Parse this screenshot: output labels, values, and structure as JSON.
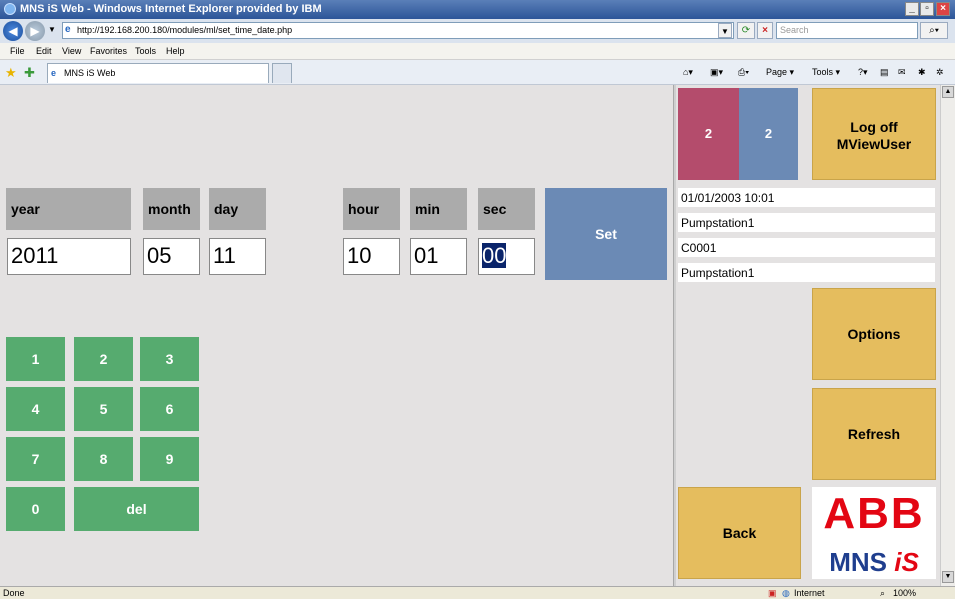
{
  "window": {
    "title": "MNS iS Web - Windows Internet Explorer provided by IBM",
    "minimize": "_",
    "maximize": "▫",
    "close": "×"
  },
  "address": {
    "url": "http://192.168.200.180/modules/ml/set_time_date.php",
    "search_placeholder": "Search",
    "back_icon": "◀",
    "forward_icon": "▶"
  },
  "menu": [
    "File",
    "Edit",
    "View",
    "Favorites",
    "Tools",
    "Help"
  ],
  "tab": {
    "label": "MNS iS Web"
  },
  "commandbar": {
    "page": "Page ▾",
    "tools": "Tools ▾",
    "zoom": "100%"
  },
  "datetime": {
    "headers": {
      "year": "year",
      "month": "month",
      "day": "day",
      "hour": "hour",
      "min": "min",
      "sec": "sec"
    },
    "values": {
      "year": "2011",
      "month": "05",
      "day": "11",
      "hour": "10",
      "min": "01",
      "sec": "00"
    },
    "set_label": "Set"
  },
  "keypad": {
    "keys": [
      "1",
      "2",
      "3",
      "4",
      "5",
      "6",
      "7",
      "8",
      "9",
      "0"
    ],
    "del": "del"
  },
  "sidebar": {
    "alarm_count_red": "2",
    "alarm_count_blue": "2",
    "logoff_line1": "Log off",
    "logoff_line2": "MViewUser",
    "info": [
      "01/01/2003 10:01",
      "Pumpstation1",
      "C0001",
      "Pumpstation1"
    ],
    "options": "Options",
    "refresh": "Refresh",
    "back": "Back",
    "logo_abb": "ABB",
    "logo_mns": "MNS",
    "logo_is": "iS"
  },
  "status": {
    "left": "Done",
    "zone": "Internet",
    "zoom": "100%"
  },
  "colors": {
    "header_gray": "#ababab",
    "set_blue": "#6b8ab5",
    "keypad_green": "#56ab6f",
    "button_yellow": "#e5bd5e",
    "alarm_red": "#b44c6c"
  }
}
